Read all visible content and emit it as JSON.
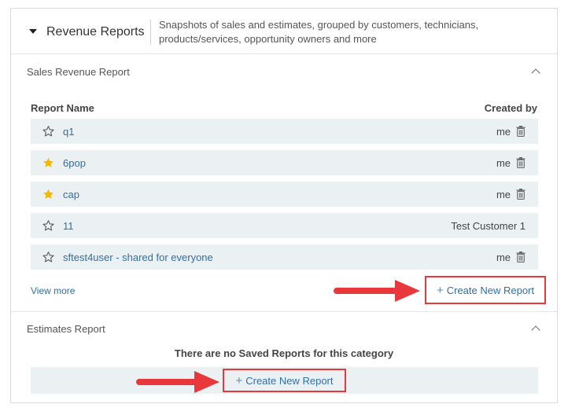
{
  "header": {
    "title": "Revenue Reports",
    "description": "Snapshots of sales and estimates, grouped by customers, technicians, products/services, opportunity owners and more"
  },
  "sales_section": {
    "title": "Sales Revenue Report",
    "columns": {
      "name": "Report Name",
      "created_by": "Created by"
    },
    "rows": [
      {
        "name": "q1",
        "owner": "me",
        "starred": false,
        "deletable": true
      },
      {
        "name": "6pop",
        "owner": "me",
        "starred": true,
        "deletable": true
      },
      {
        "name": "cap",
        "owner": "me",
        "starred": true,
        "deletable": true
      },
      {
        "name": "11",
        "owner": "Test Customer 1",
        "starred": false,
        "deletable": false
      },
      {
        "name": "sftest4user - shared for everyone",
        "owner": "me",
        "starred": false,
        "deletable": true
      }
    ],
    "view_more": "View more",
    "create_label": "Create New Report"
  },
  "estimates_section": {
    "title": "Estimates Report",
    "empty_message": "There are no Saved Reports for this category",
    "create_label": "Create New Report"
  },
  "colors": {
    "link": "#2f6fa8",
    "star_filled": "#f5b800",
    "highlight": "#e8383d",
    "row_bg": "#ebf0f2"
  }
}
